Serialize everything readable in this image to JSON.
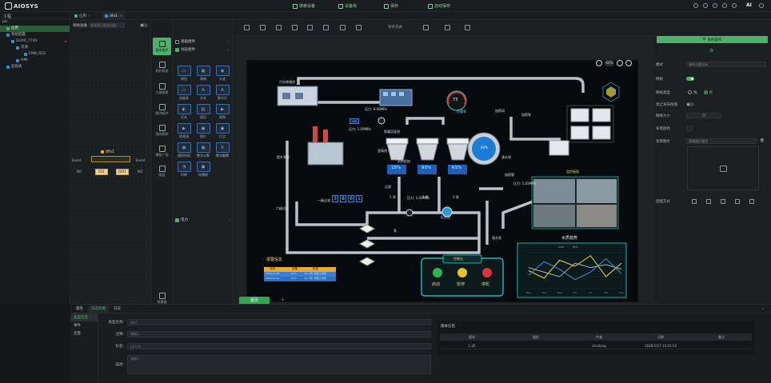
{
  "app": {
    "brand": "AIOSYS",
    "top_actions": [
      "搜索设备",
      "设备库",
      "保存",
      "自动保存"
    ],
    "user_avatar": "AI"
  },
  "tree": {
    "header": "工程",
    "nodes": [
      {
        "label": "plc",
        "level": 0
      },
      {
        "label": "应用",
        "level": 1,
        "selected": true
      },
      {
        "label": "系统配置",
        "level": 1
      },
      {
        "label": "DUX0_7740",
        "level": 2,
        "alert": true
      },
      {
        "label": "资源",
        "level": 3
      },
      {
        "label": "EMB_RES",
        "level": 4
      },
      {
        "label": "HMI",
        "level": 3
      },
      {
        "label": "监视表",
        "level": 2
      }
    ]
  },
  "doc_tabs": [
    {
      "label": "应用",
      "active": false
    },
    {
      "label": "dfx1",
      "active": true
    }
  ],
  "logic": {
    "label": "调试设备",
    "placeholder": "请选择已连接设备",
    "block_title": "dfx1",
    "left_port_top": "Event",
    "left_port_bottom": "IN1",
    "right_port_top": "Event",
    "right_port_bottom": "IN1",
    "block_in": "DI1",
    "block_out": "DO1"
  },
  "side_icons": [
    {
      "label": "基本组件",
      "active": true
    },
    {
      "label": "拓扑组态",
      "active": false
    },
    {
      "label": "大屏图表",
      "active": false
    },
    {
      "label": "缓冲组件",
      "active": false
    },
    {
      "label": "我的图库",
      "active": false
    },
    {
      "label": "模板广场",
      "active": false
    },
    {
      "label": "图层",
      "active": false
    },
    {
      "label": "快捷键",
      "active": false
    }
  ],
  "component_lib": {
    "section1": "基础组件",
    "section2": "动态组件",
    "section3": "电力",
    "items": [
      {
        "label": "按钮",
        "glyph": "▭"
      },
      {
        "label": "表格",
        "glyph": "▦"
      },
      {
        "label": "水波",
        "glyph": "◉"
      },
      {
        "label": "进度条",
        "glyph": "▭"
      },
      {
        "label": "文本",
        "glyph": "A"
      },
      {
        "label": "跑马灯",
        "glyph": "A"
      },
      {
        "label": "开关",
        "glyph": "◐"
      },
      {
        "label": "网页",
        "glyph": "▤"
      },
      {
        "label": "视频",
        "glyph": "▶"
      },
      {
        "label": "视频流",
        "glyph": "▶"
      },
      {
        "label": "图片",
        "glyph": "▣"
      },
      {
        "label": "打点",
        "glyph": "▣"
      },
      {
        "label": "通用时间",
        "glyph": "▦"
      },
      {
        "label": "数字计数",
        "glyph": "▦"
      },
      {
        "label": "数字翻牌",
        "glyph": "X"
      },
      {
        "label": "时钟",
        "glyph": "◔"
      },
      {
        "label": "轮播图",
        "glyph": "▣"
      }
    ]
  },
  "canvas_toolbar": {
    "align_label": "对齐方式"
  },
  "zoom": {
    "value": "64%"
  },
  "stage": {
    "label_raw_water": "污水原储池",
    "label_pressure1": "压力: 0.00MPa",
    "label_pressure2": "压力: 1.00MPa",
    "label_pressure3": "压力: 1.05MPa",
    "label_pressure4": "压力: 1.05MPa",
    "label_lift": "提升泵站",
    "label_coag": "絮凝沉淀池",
    "label_clarify": "澄清池",
    "label_filter": "过滤",
    "label_pump_room": "加药间",
    "label_load": "负载率",
    "label_dosing": "加药泵",
    "label_tank_level": "清水池",
    "label_dosing2": "加药管",
    "label_cctv": "监控画面",
    "label_sludge": "出泥",
    "label_chem": "药剂投加",
    "label_mech": "机械搅拌",
    "label_second": "二级过滤",
    "label_reactor": "反应池",
    "label_clean_pump": "清水泵",
    "label_valve": "阀门",
    "label_pump2": "泵",
    "label_digit": "一级过滤",
    "digits": [
      "3",
      "8",
      "6",
      "1"
    ],
    "label_1": "1 泵",
    "label_2": "2 泵",
    "label_3": "3 泵",
    "pct1": "15%",
    "pct2": "93%",
    "pct3": "61%",
    "tank_pct": "82%",
    "gauge_val": "73",
    "panel_title": "控制台",
    "btn_start": "启动",
    "btn_pause": "暂停",
    "btn_stop": "停机",
    "alarm_title": "报警信息",
    "alarm_headers": [
      "时间",
      "设备",
      "信息"
    ],
    "alarm_rows": [
      [
        "2026-01-04",
        "Pum",
        "No.1泵, 泵超工作频"
      ],
      [
        "2026-01-04",
        "Pum",
        "No.2泵, 泵超工作频"
      ]
    ],
    "trend_title": "水质趋势",
    "trend_legend": [
      "COD",
      "NH3"
    ],
    "trend_x": [
      "Mon",
      "Tue",
      "Wed",
      "Thu",
      "Fri",
      "Sat",
      "Sun"
    ],
    "trend_values_a": [
      60,
      35,
      95,
      75,
      110,
      40,
      85
    ],
    "trend_values_b": [
      45,
      90,
      65,
      30,
      55,
      100,
      50
    ],
    "trend_values_c": [
      70,
      55,
      40,
      85,
      70,
      80,
      65
    ],
    "trend_ylim": [
      0,
      120
    ]
  },
  "page_tab": "首页",
  "page_add": "+",
  "props": {
    "header_btn": "系统操作",
    "rows": [
      {
        "label": "模式",
        "value": "画布大屏设计"
      },
      {
        "label": "网格",
        "value": ""
      },
      {
        "label": "网格类型",
        "option1": "线",
        "option2": "点"
      },
      {
        "label": "禁止背布拖拽",
        "value": ""
      },
      {
        "label": "网格大小",
        "value": "20"
      },
      {
        "label": "背景颜色",
        "value": ""
      },
      {
        "label": "背景图片",
        "value": "背景图片路径"
      },
      {
        "label": "适配方式",
        "value": ""
      }
    ]
  },
  "bottom": {
    "tabs": [
      "属性",
      "日志终端",
      "日志"
    ],
    "active_tab": 1,
    "side": [
      "类型信息",
      "事件",
      "变量"
    ],
    "fields": [
      {
        "label": "类型名称:",
        "value": "dfx1"
      },
      {
        "label": "注释:",
        "value": "请输入"
      },
      {
        "label": "标签:",
        "value": "v1.0.0"
      },
      {
        "label": "描述:",
        "value": "请输入"
      }
    ],
    "version_title": "版本信息",
    "version_headers": [
      "版本",
      "组织",
      "作者",
      "日期",
      "备注"
    ],
    "version_row": [
      "1.26",
      "",
      "zmatang",
      "2026/1/27 14:41:54",
      ""
    ]
  },
  "colors": {
    "accent": "#4cb26a",
    "panel_cyan": "#1fd9d9",
    "pipe": "#b9c2c8",
    "trend_a": "#e8e13a",
    "trend_b": "#3a8fe8",
    "trend_c": "#a8b0b8"
  }
}
